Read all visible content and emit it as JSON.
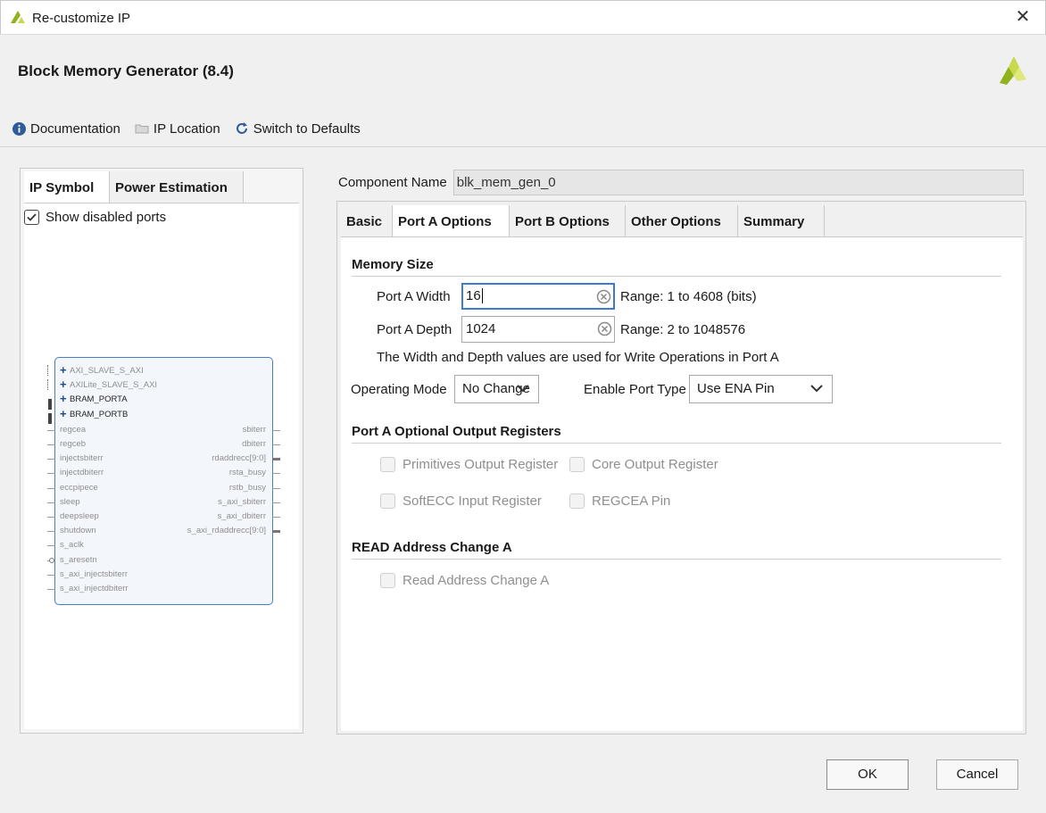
{
  "window": {
    "title": "Re-customize IP"
  },
  "header": {
    "heading": "Block Memory Generator (8.4)"
  },
  "toolbar": {
    "documentation": "Documentation",
    "ip_location": "IP Location",
    "switch_defaults": "Switch to Defaults"
  },
  "left": {
    "tabs": [
      "IP Symbol",
      "Power Estimation"
    ],
    "show_disabled_ports": "Show disabled ports",
    "symbol": {
      "bus_ports": [
        "AXI_SLAVE_S_AXI",
        "AXILite_SLAVE_S_AXI",
        "BRAM_PORTA",
        "BRAM_PORTB"
      ],
      "left_ports": [
        "regcea",
        "regceb",
        "injectsbiterr",
        "injectdbiterr",
        "eccpipece",
        "sleep",
        "deepsleep",
        "shutdown",
        "s_aclk",
        "s_aresetn",
        "s_axi_injectsbiterr",
        "s_axi_injectdbiterr"
      ],
      "right_ports": [
        "sbiterr",
        "dbiterr",
        "rdaddrecc[9:0]",
        "rsta_busy",
        "rstb_busy",
        "s_axi_sbiterr",
        "s_axi_dbiterr",
        "s_axi_rdaddrecc[9:0]"
      ]
    }
  },
  "component": {
    "label": "Component Name",
    "value": "blk_mem_gen_0"
  },
  "tabs": [
    "Basic",
    "Port A Options",
    "Port B Options",
    "Other Options",
    "Summary"
  ],
  "memory_size": {
    "title": "Memory Size",
    "width_label": "Port A Width",
    "width_value": "16",
    "width_range": "Range: 1 to 4608 (bits)",
    "depth_label": "Port A Depth",
    "depth_value": "1024",
    "depth_range": "Range: 2 to 1048576",
    "note": "The Width and Depth values are used for Write Operations in Port A"
  },
  "modes": {
    "operating_label": "Operating Mode",
    "operating_value": "No Change",
    "enable_label": "Enable Port Type",
    "enable_value": "Use ENA Pin"
  },
  "output_regs": {
    "title": "Port A Optional Output Registers",
    "primitives": "Primitives Output Register",
    "core": "Core Output Register",
    "softecc": "SoftECC Input Register",
    "regcea": "REGCEA Pin"
  },
  "read_addr": {
    "title": "READ Address Change A",
    "option": "Read Address Change A"
  },
  "buttons": {
    "ok": "OK",
    "cancel": "Cancel"
  },
  "colors": {
    "accent": "#3d7ad6",
    "symbol_border": "#4a7ebb",
    "brand": "#8fb21d"
  }
}
